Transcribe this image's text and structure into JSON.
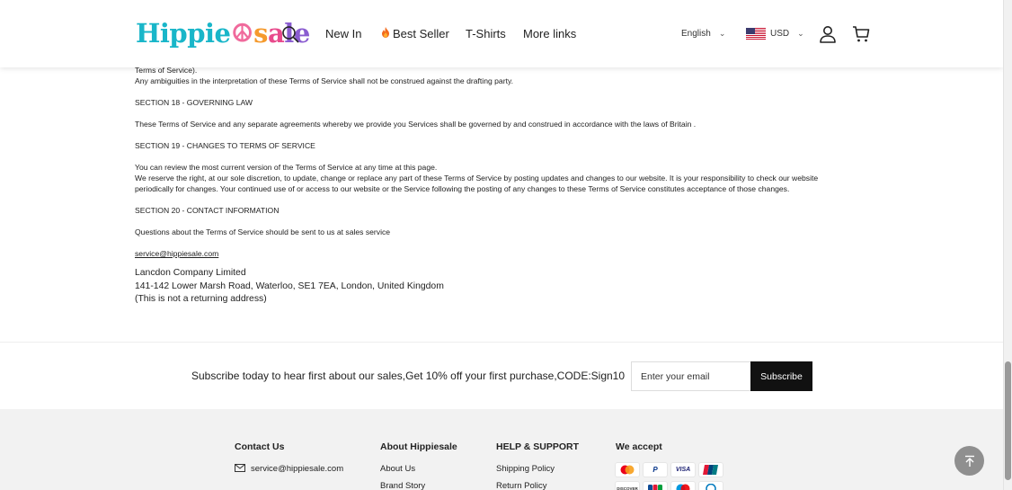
{
  "header": {
    "logo": {
      "part1": "Hippie",
      "part2": "s",
      "part3": "a",
      "part4": "le"
    },
    "nav": {
      "new_in": "New In",
      "best_seller": "Best Seller",
      "tshirts": "T-Shirts",
      "more_links": "More links"
    },
    "language": "English",
    "currency": "USD"
  },
  "content": {
    "lines": [
      "Terms of Service).",
      "Any ambiguities in the interpretation of these Terms of Service shall not be construed against the drafting party.",
      "SECTION 18 - GOVERNING LAW",
      "These Terms of Service and any separate agreements whereby we provide you Services shall be governed by and construed in accordance with the laws of Britain .",
      "SECTION 19 - CHANGES TO TERMS OF SERVICE",
      "You can review the most current version of the Terms of Service at any time at this page.",
      "We reserve the right, at our sole discretion, to update, change or replace any part of these Terms of Service by posting updates and changes to our website. It is your responsibility to check our website",
      "periodically for changes. Your continued use of or access to our website or the Service following the posting of any changes to these Terms of Service constitutes acceptance of those changes.",
      "SECTION 20 - CONTACT INFORMATION",
      "Questions about the Terms of Service should be sent to us at sales service",
      "service@hippiesale.com"
    ],
    "address": [
      "Lancdon Company Limited",
      "141-142 Lower Marsh Road, Waterloo, SE1 7EA, London, United Kingdom",
      "(This is not a returning address)"
    ]
  },
  "subscribe": {
    "text": "Subscribe today to hear first about our sales,Get 10% off your first purchase,CODE:Sign10",
    "placeholder": "Enter your email",
    "button": "Subscribe"
  },
  "footer": {
    "contact": {
      "heading": "Contact Us",
      "email": "service@hippiesale.com"
    },
    "about": {
      "heading": "About Hippiesale",
      "links": [
        "About Us",
        "Brand Story"
      ]
    },
    "help": {
      "heading": "HELP & SUPPORT",
      "links": [
        "Shipping Policy",
        "Return Policy"
      ]
    },
    "accept": {
      "heading": "We accept",
      "row1": [
        "mastercard",
        "P",
        "VISA",
        "unionpay"
      ],
      "row2": [
        "DISCOVER",
        "JCB",
        "maestro",
        "diners"
      ]
    }
  },
  "colors": {
    "accent": "#111111",
    "footer_bg": "#f2f2f2",
    "back_to_top": "#8f8f8f"
  }
}
